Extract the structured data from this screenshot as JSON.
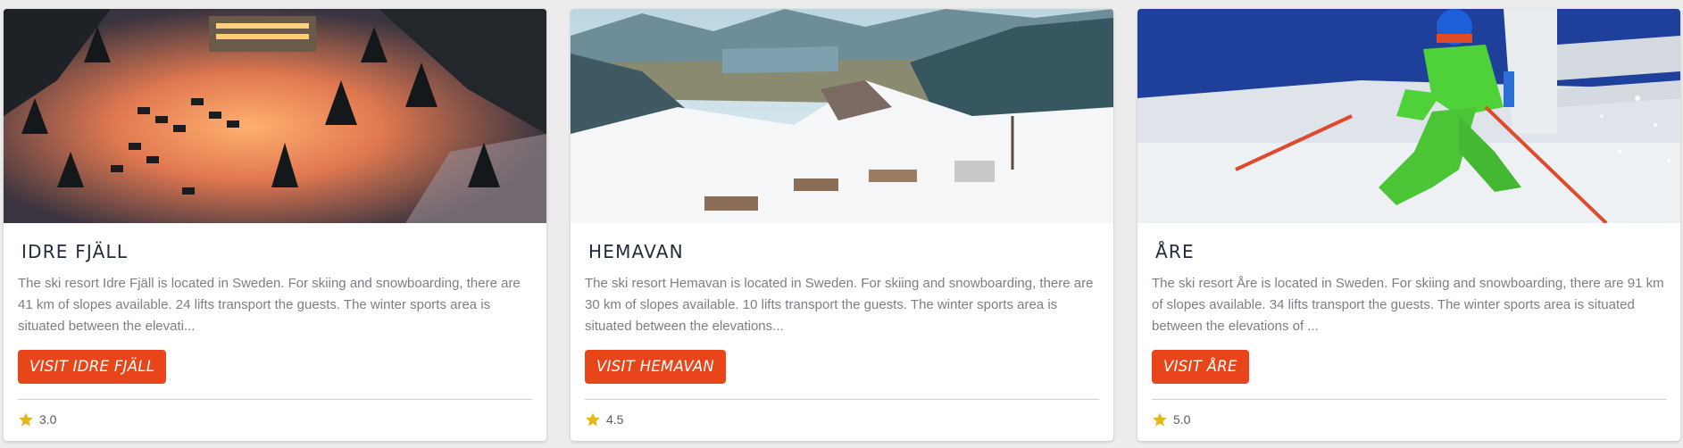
{
  "cards": [
    {
      "title": "IDRE FJÄLL",
      "description": "The ski resort Idre Fjäll is located in Sweden. For skiing and snowboarding, there are 41 km of slopes available. 24 lifts transport the guests. The winter sports area is situated between the elevati...",
      "button_label": "VISIT IDRE FJÄLL",
      "rating": "3.0",
      "image_icon": "night-resort-photo"
    },
    {
      "title": "HEMAVAN",
      "description": "The ski resort Hemavan is located in Sweden. For skiing and snowboarding, there are 30 km of slopes available. 10 lifts transport the guests. The winter sports area is situated between the elevations...",
      "button_label": "VISIT HEMAVAN",
      "rating": "4.5",
      "image_icon": "mountain-valley-photo"
    },
    {
      "title": "ÅRE",
      "description": "The ski resort Åre is located in Sweden. For skiing and snowboarding, there are 91 km of slopes available. 34 lifts transport the guests. The winter sports area is situated between the elevations of ...",
      "button_label": "VISIT ÅRE",
      "rating": "5.0",
      "image_icon": "skier-photo"
    }
  ],
  "colors": {
    "button": "#e8461a",
    "star": "#e3b81c",
    "title": "#1f2b3a",
    "text": "#7a7f86"
  }
}
